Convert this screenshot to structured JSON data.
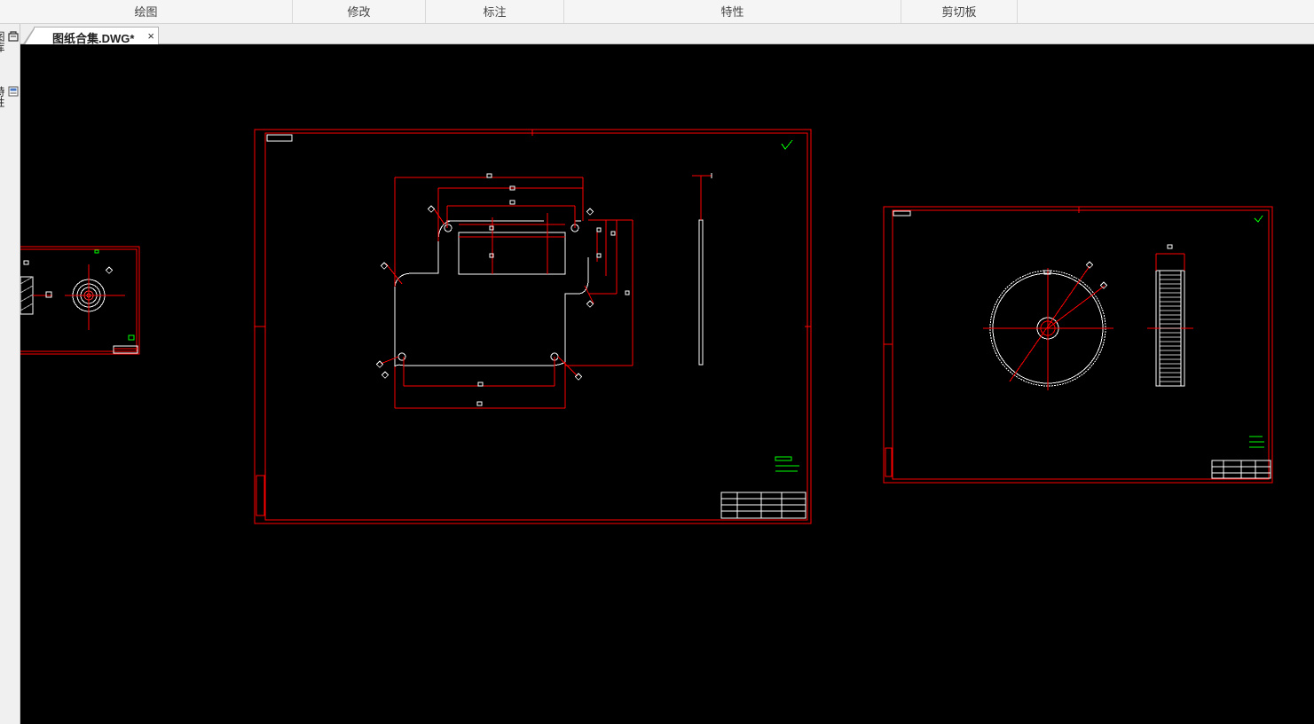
{
  "ribbon": {
    "groups": [
      "绘图",
      "修改",
      "标注",
      "特性",
      "剪切板"
    ]
  },
  "tabs": {
    "document": {
      "label": "图纸合集.DWG*",
      "close_label": "×"
    }
  },
  "side_dock": {
    "items": [
      {
        "label": "图库",
        "icon": "library-icon"
      },
      {
        "label": "特性",
        "icon": "properties-icon"
      }
    ]
  },
  "canvas": {
    "background": "#000000",
    "frame_color": "#ff0000",
    "geometry_color": "#ffffff",
    "annotation_color": "#00ff00"
  }
}
